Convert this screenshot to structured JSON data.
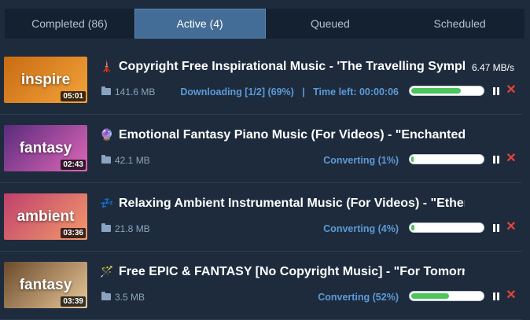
{
  "tabs": [
    {
      "label": "Completed (86)",
      "active": false
    },
    {
      "label": "Active (4)",
      "active": true
    },
    {
      "label": "Queued",
      "active": false
    },
    {
      "label": "Scheduled",
      "active": false
    }
  ],
  "downloads": [
    {
      "thumb_text": "inspire",
      "duration": "05:01",
      "icon": "tower-icon",
      "icon_glyph": "🗼",
      "title": "Copyright Free Inspirational Music - 'The Travelling Symphon...",
      "speed": "6.47 MB/s",
      "size": "141.6 MB",
      "status": "Downloading [1/2] (69%)   |   Time left: 00:00:06",
      "progress": 0.69,
      "thumb_colors": [
        "#c96b12",
        "#f3a43a"
      ]
    },
    {
      "thumb_text": "fantasy",
      "duration": "02:43",
      "icon": "crystal-ball-icon",
      "icon_glyph": "🔮",
      "title": "Emotional Fantasy Piano Music (For Videos) - \"Enchanted\" b...",
      "speed": "",
      "size": "42.1 MB",
      "status": "Converting (1%)",
      "progress": 0.01,
      "thumb_colors": [
        "#5a2b7d",
        "#e067b8"
      ]
    },
    {
      "thumb_text": "ambient",
      "duration": "03:36",
      "icon": "sleep-icon",
      "icon_glyph": "💤",
      "title": "Relaxing Ambient Instrumental Music (For Videos) - \"Ethere...",
      "speed": "",
      "size": "21.8 MB",
      "status": "Converting (4%)",
      "progress": 0.04,
      "thumb_colors": [
        "#c0406c",
        "#f39b6c"
      ]
    },
    {
      "thumb_text": "fantasy",
      "duration": "03:39",
      "icon": "magic-wand-icon",
      "icon_glyph": "🪄",
      "title": "Free EPIC & FANTASY [No Copyright Music] - \"For Tomorro...",
      "speed": "",
      "size": "3.5 MB",
      "status": "Converting (52%)",
      "progress": 0.52,
      "thumb_colors": [
        "#6b4a2c",
        "#e9c89a"
      ]
    }
  ],
  "colors": {
    "background": "#1d2b3d",
    "tab_bar": "#142131",
    "tab_active": "#436c96",
    "status_text": "#5e9ad6",
    "progress_fill": "#4cc55a",
    "cancel": "#e8443b"
  }
}
